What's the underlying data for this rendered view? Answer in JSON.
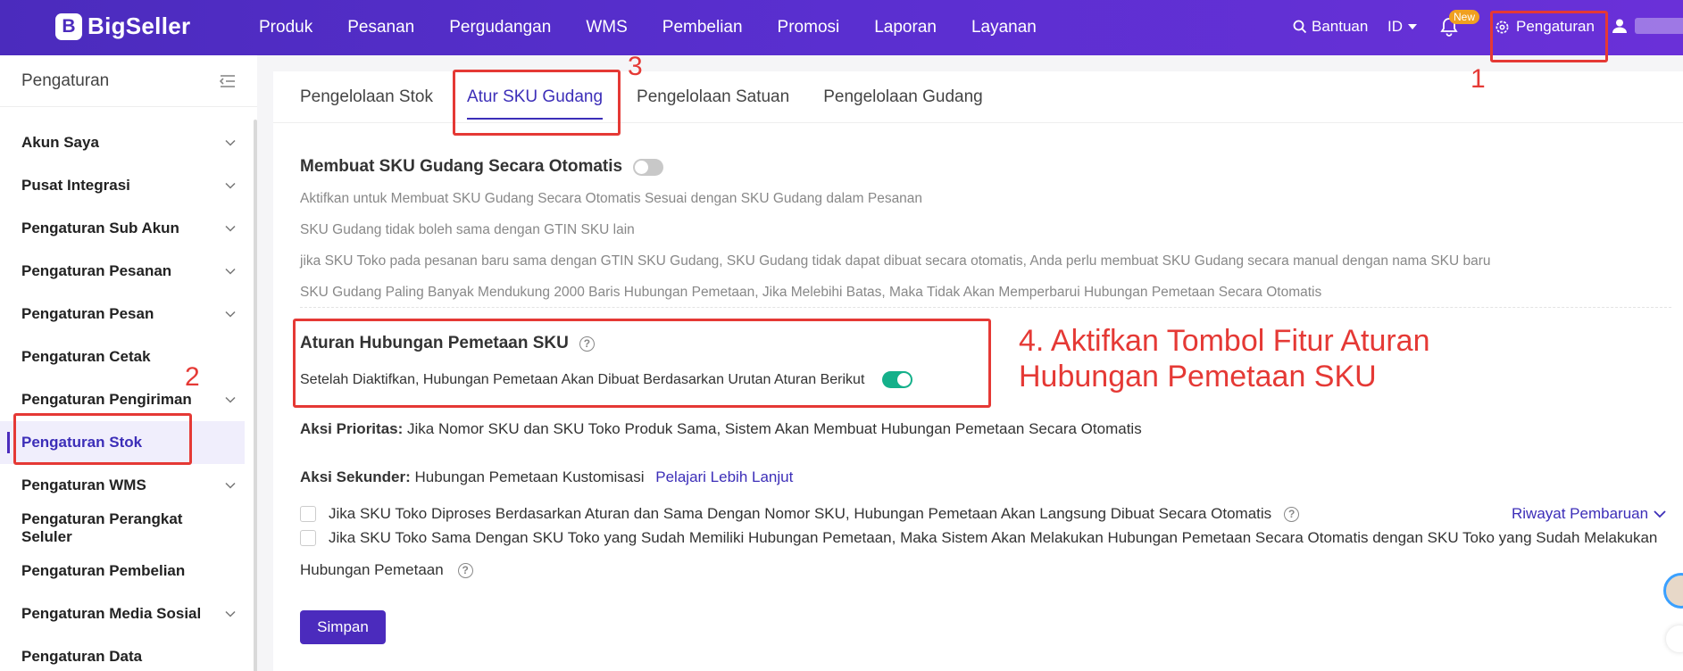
{
  "topbar": {
    "brand": "BigSeller",
    "brand_mark": "B",
    "nav": [
      "Produk",
      "Pesanan",
      "Pergudangan",
      "WMS",
      "Pembelian",
      "Promosi",
      "Laporan",
      "Layanan"
    ],
    "help": "Bantuan",
    "lang": "ID",
    "new_badge": "New",
    "settings": "Pengaturan"
  },
  "sidebar": {
    "title": "Pengaturan",
    "items": [
      {
        "label": "Akun Saya",
        "has_children": true
      },
      {
        "label": "Pusat Integrasi",
        "has_children": true
      },
      {
        "label": "Pengaturan Sub Akun",
        "has_children": true
      },
      {
        "label": "Pengaturan Pesanan",
        "has_children": true
      },
      {
        "label": "Pengaturan Pesan",
        "has_children": true
      },
      {
        "label": "Pengaturan Cetak",
        "has_children": false
      },
      {
        "label": "Pengaturan Pengiriman",
        "has_children": true
      },
      {
        "label": "Pengaturan Stok",
        "has_children": false,
        "active": true
      },
      {
        "label": "Pengaturan WMS",
        "has_children": true
      },
      {
        "label": "Pengaturan Perangkat Seluler",
        "has_children": false
      },
      {
        "label": "Pengaturan Pembelian",
        "has_children": false
      },
      {
        "label": "Pengaturan Media Sosial",
        "has_children": true
      },
      {
        "label": "Pengaturan Data",
        "has_children": false
      }
    ]
  },
  "tabs": [
    "Pengelolaan Stok",
    "Atur SKU Gudang",
    "Pengelolaan Satuan",
    "Pengelolaan Gudang"
  ],
  "active_tab": "Atur SKU Gudang",
  "auto_sku": {
    "title": "Membuat SKU Gudang Secara Otomatis",
    "enabled": false,
    "notes": [
      "Aktifkan untuk Membuat SKU Gudang Secara Otomatis Sesuai dengan SKU Gudang dalam Pesanan",
      "SKU Gudang tidak boleh sama dengan GTIN SKU lain",
      "jika SKU Toko pada pesanan baru sama dengan GTIN SKU Gudang, SKU Gudang tidak dapat dibuat secara otomatis, Anda perlu membuat SKU Gudang secara manual dengan nama SKU baru",
      "SKU Gudang Paling Banyak Mendukung 2000 Baris Hubungan Pemetaan, Jika Melebihi Batas, Maka Tidak Akan Memperbarui Hubungan Pemetaan Secara Otomatis"
    ]
  },
  "mapping_rule": {
    "title": "Aturan Hubungan Pemetaan SKU",
    "desc": "Setelah Diaktifkan, Hubungan Pemetaan Akan Dibuat Berdasarkan Urutan Aturan Berikut",
    "enabled": true
  },
  "priority": {
    "label": "Aksi Prioritas:",
    "text": " Jika Nomor SKU dan SKU Toko Produk Sama, Sistem Akan Membuat Hubungan Pemetaan Secara Otomatis"
  },
  "secondary": {
    "label": "Aksi Sekunder:",
    "text": " Hubungan Pemetaan Kustomisasi",
    "link": "Pelajari Lebih Lanjut",
    "options": [
      "Jika SKU Toko Diproses Berdasarkan Aturan dan Sama Dengan Nomor SKU, Hubungan Pemetaan Akan Langsung Dibuat Secara Otomatis",
      "Jika SKU Toko Sama Dengan SKU Toko yang Sudah Memiliki Hubungan Pemetaan, Maka Sistem Akan Melakukan Hubungan Pemetaan Secara Otomatis dengan SKU Toko yang Sudah Melakukan"
    ],
    "option2_cont": "Hubungan Pemetaan"
  },
  "history_link": "Riwayat Pembaruan",
  "save_label": "Simpan",
  "annotations": {
    "n1": "1",
    "n2": "2",
    "n3": "3",
    "step4": "4. Aktifkan Tombol Fitur Aturan Hubungan Pemetaan SKU"
  },
  "colors": {
    "topbar": "#4b2bbd",
    "accent": "#3c2eb8",
    "toggle_on": "#14b08a",
    "annotation": "#e53935"
  }
}
